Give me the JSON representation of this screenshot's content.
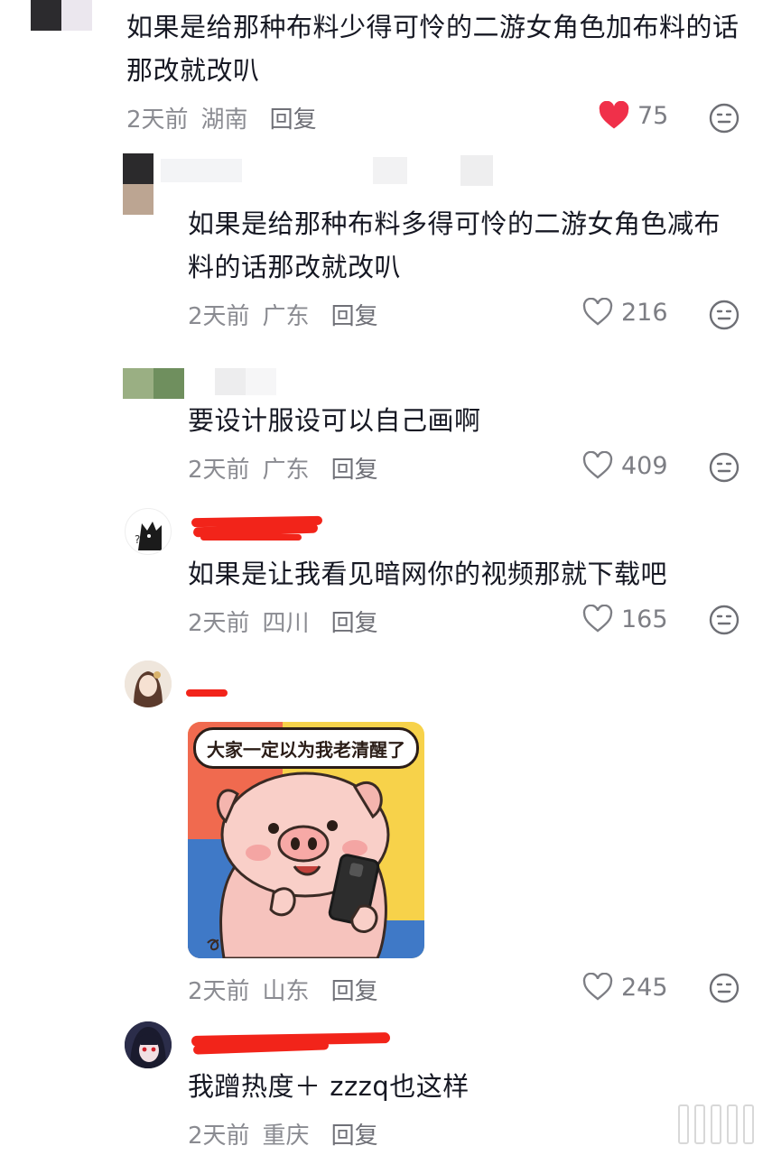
{
  "comments": [
    {
      "text": "如果是给那种布料少得可怜的二游女角色加布料的话那改就改叭",
      "time": "2天前",
      "location": "湖南",
      "reply_label": "回复",
      "likes": "75",
      "liked": true
    },
    {
      "text": "如果是给那种布料多得可怜的二游女角色减布料的话那改就改叭",
      "time": "2天前",
      "location": "广东",
      "reply_label": "回复",
      "likes": "216",
      "liked": false
    },
    {
      "text": "要设计服设可以自己画啊",
      "time": "2天前",
      "location": "广东",
      "reply_label": "回复",
      "likes": "409",
      "liked": false
    },
    {
      "text": "如果是让我看见暗网你的视频那就下载吧",
      "time": "2天前",
      "location": "四川",
      "reply_label": "回复",
      "likes": "165",
      "liked": false
    },
    {
      "sticker_text": "大家一定以为我老清醒了",
      "time": "2天前",
      "location": "山东",
      "reply_label": "回复",
      "likes": "245",
      "liked": false
    },
    {
      "text": "我蹭热度＋ zzzq也这样",
      "time": "2天前",
      "location": "重庆",
      "reply_label": "回复"
    }
  ],
  "colors": {
    "liked_heart": "#f0304a",
    "redaction": "#f2241a",
    "meta_text": "#8a8b91"
  },
  "icons": [
    "heart-icon",
    "heart-outline-icon",
    "neutral-face-icon"
  ]
}
